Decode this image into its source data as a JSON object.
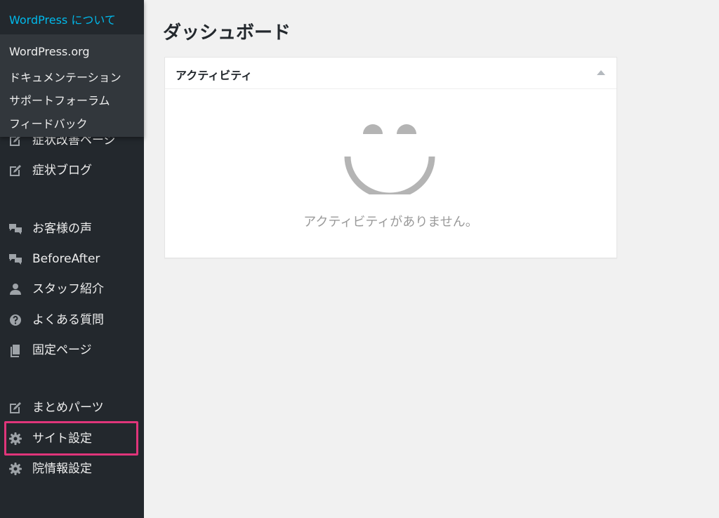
{
  "wp_menu": {
    "title": "WordPress について",
    "links": [
      "WordPress.org",
      "ドキュメンテーション",
      "サポートフォーラム",
      "フィードバック"
    ]
  },
  "sidebar": {
    "items": [
      {
        "label": "症状改善ページ",
        "icon": "edit-icon"
      },
      {
        "label": "症状ブログ",
        "icon": "edit-icon"
      },
      {
        "label": "お客様の声",
        "icon": "comments-icon"
      },
      {
        "label": "BeforeAfter",
        "icon": "comments-icon"
      },
      {
        "label": "スタッフ紹介",
        "icon": "user-icon"
      },
      {
        "label": "よくある質問",
        "icon": "question-icon"
      },
      {
        "label": "固定ページ",
        "icon": "page-icon"
      },
      {
        "label": "まとめパーツ",
        "icon": "edit-icon"
      },
      {
        "label": "サイト設定",
        "icon": "gear-icon"
      },
      {
        "label": "院情報設定",
        "icon": "gear-icon"
      }
    ],
    "highlight_color": "#e0357a"
  },
  "main": {
    "page_title": "ダッシュボード",
    "activity_panel": {
      "title": "アクティビティ",
      "empty_message": "アクティビティがありません。"
    }
  },
  "colors": {
    "sidebar_bg": "#23282d",
    "accent": "#00b9eb",
    "page_bg": "#f1f1f1"
  }
}
